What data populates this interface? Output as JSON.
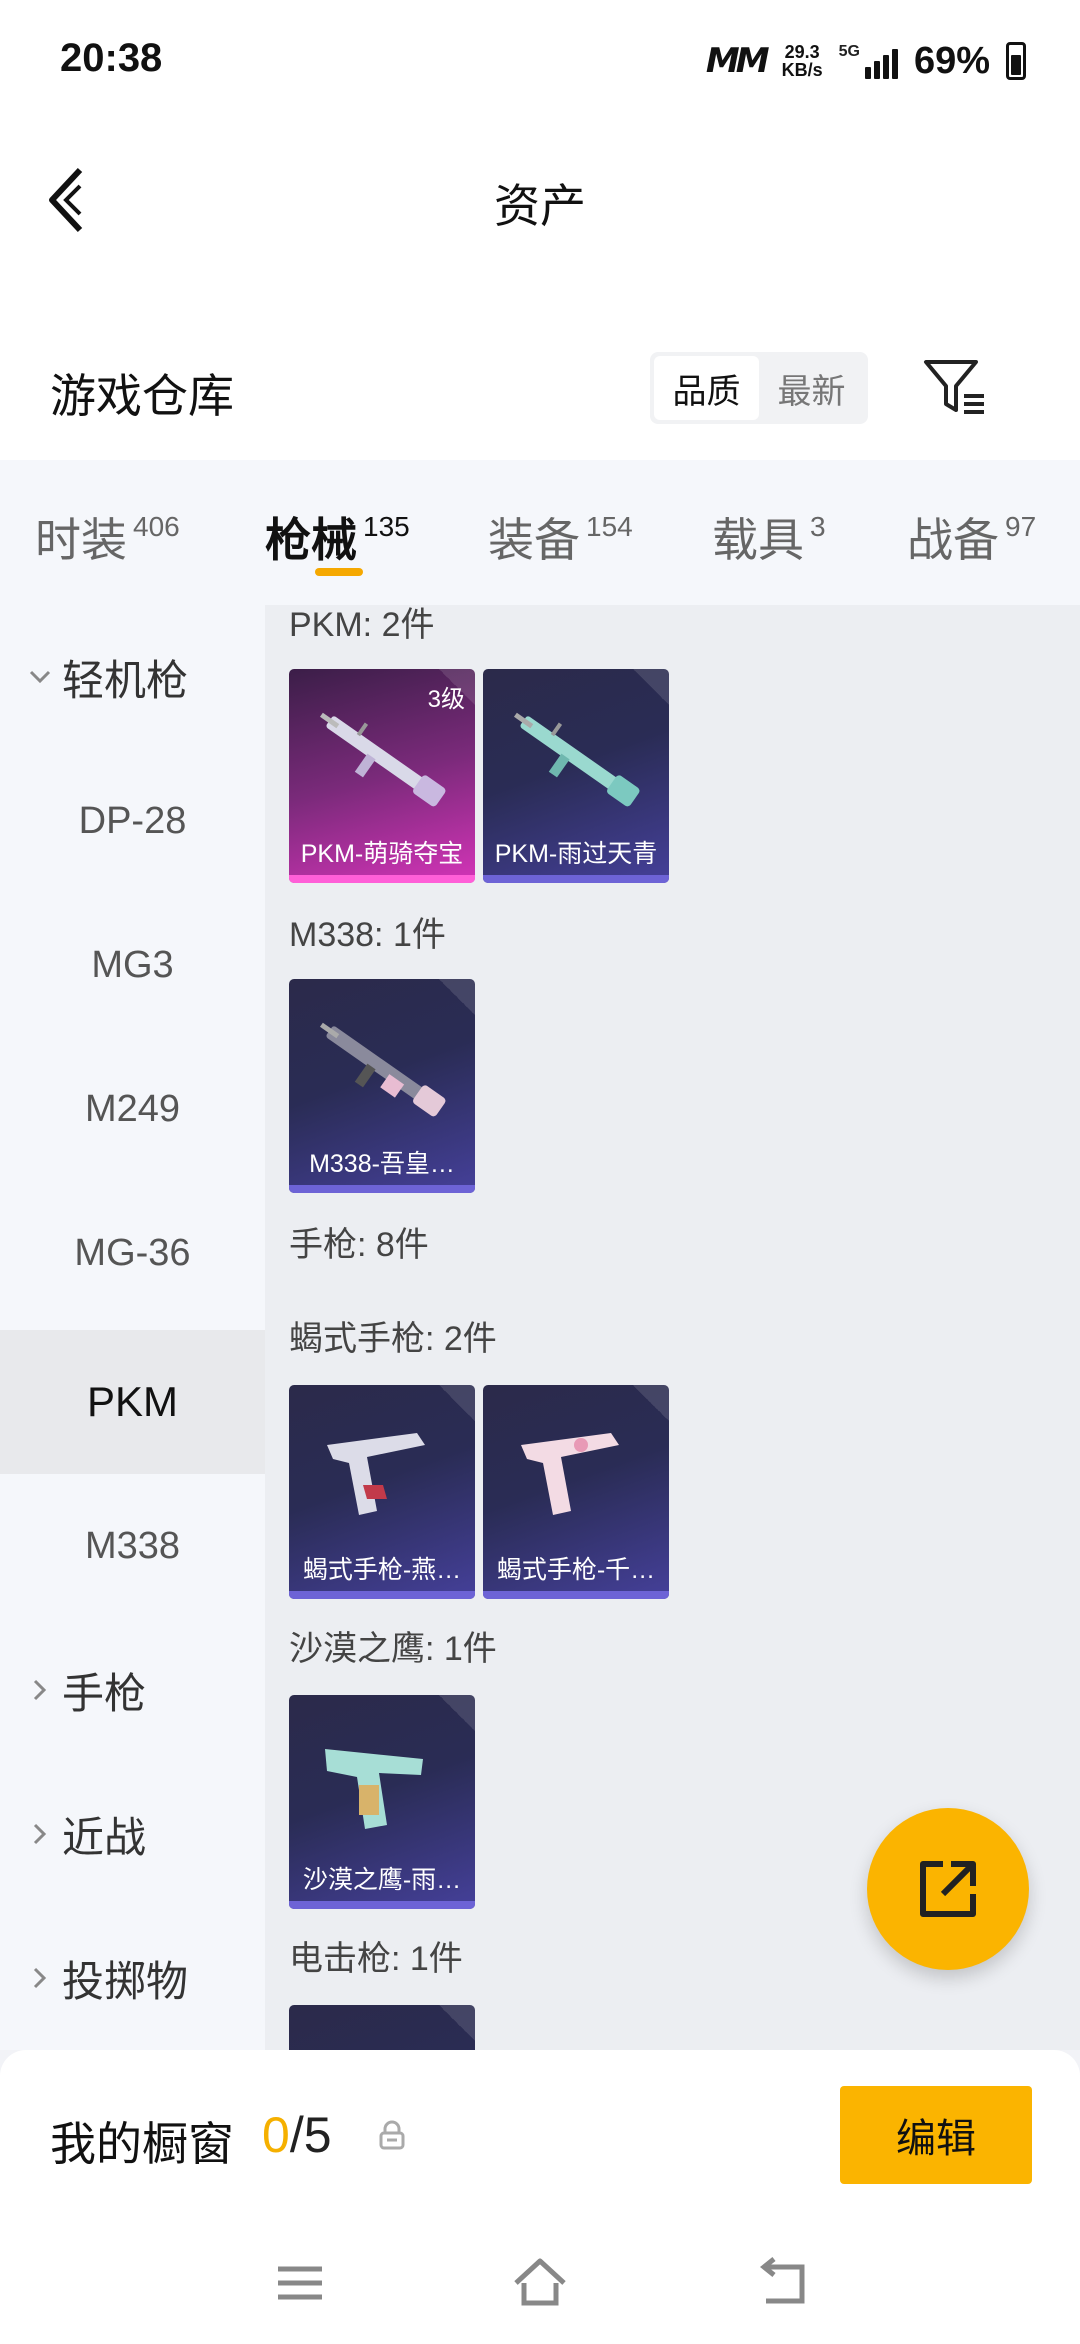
{
  "status_bar": {
    "time": "20:38",
    "net_logo": "ⅯⅯ",
    "speed_value": "29.3",
    "speed_unit": "KB/s",
    "network": "5G",
    "battery": "69%"
  },
  "header": {
    "title": "资产",
    "back_icon": "chevron-left-icon"
  },
  "warehouse": {
    "title": "游戏仓库",
    "sort_options": [
      "品质",
      "最新"
    ],
    "sort_selected": "品质",
    "filter_icon": "filter-icon"
  },
  "tabs": [
    {
      "label": "时装",
      "count": "406"
    },
    {
      "label": "枪械",
      "count": "135"
    },
    {
      "label": "装备",
      "count": "154"
    },
    {
      "label": "载具",
      "count": "3"
    },
    {
      "label": "战备",
      "count": "97"
    }
  ],
  "active_tab": "枪械",
  "sidebar": {
    "category_open": "轻机枪",
    "subitems": [
      "DP-28",
      "MG3",
      "M249",
      "MG-36",
      "PKM",
      "M338"
    ],
    "active_subitem": "PKM",
    "categories_closed": [
      "手枪",
      "近战",
      "投掷物"
    ]
  },
  "content": {
    "groups": [
      {
        "label": "PKM: 2件",
        "items": [
          {
            "name": "PKM-萌骑夺宝",
            "level": "3级",
            "rarity_color": "#d434b8"
          },
          {
            "name": "PKM-雨过天青",
            "rarity_color": "#6d63d6"
          }
        ]
      },
      {
        "label": "M338: 1件",
        "items": [
          {
            "name": "M338-吾皇…",
            "rarity_color": "#6d63d6"
          }
        ]
      },
      {
        "label": "手枪: 8件",
        "items": []
      },
      {
        "label": "蝎式手枪: 2件",
        "items": [
          {
            "name": "蝎式手枪-燕…",
            "rarity_color": "#6d63d6"
          },
          {
            "name": "蝎式手枪-千…",
            "rarity_color": "#6d63d6"
          }
        ]
      },
      {
        "label": "沙漠之鹰: 1件",
        "items": [
          {
            "name": "沙漠之鹰-雨…",
            "rarity_color": "#6d63d6"
          }
        ]
      },
      {
        "label": "电击枪: 1件",
        "items": []
      }
    ]
  },
  "fab_icon": "share-external-icon",
  "bottom": {
    "title": "我的橱窗",
    "count_used": "0",
    "count_total": "/5",
    "lock_icon": "lock-icon",
    "edit_label": "编辑"
  },
  "nav": {
    "menu_icon": "menu-icon",
    "home_icon": "home-icon",
    "back_icon": "back-icon"
  }
}
